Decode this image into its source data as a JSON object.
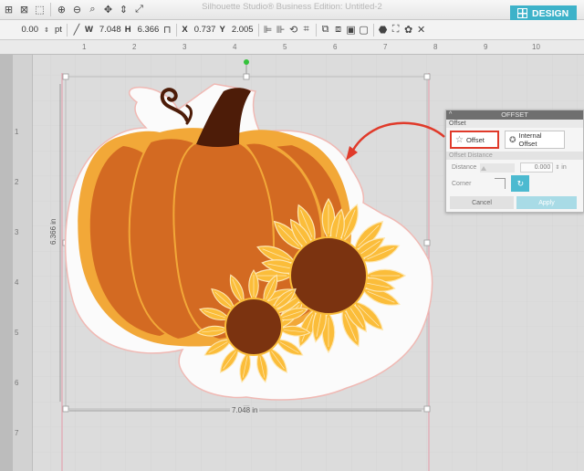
{
  "window": {
    "title": "Silhouette Studio® Business Edition: Untitled-2"
  },
  "topbar": {
    "icons": [
      "select-all-icon",
      "deselect-icon",
      "select-tool-icon",
      "zoom-in-icon",
      "zoom-out-icon",
      "zoom-box-icon",
      "pan-icon",
      "fit-to-page-icon",
      "full-screen-icon"
    ],
    "design_label": "DESIGN"
  },
  "toolbar2": {
    "line_weight": "0.00",
    "line_unit": "pt",
    "width_label": "W",
    "width_value": "7.048",
    "height_label": "H",
    "height_value": "6.366",
    "x_label": "X",
    "x_value": "0.737",
    "y_label": "Y",
    "y_value": "2.005"
  },
  "canvas": {
    "width_dimension": "7.048 in",
    "height_dimension": "6.366 in"
  },
  "ruler": {
    "top_labels": [
      "1",
      "2",
      "3",
      "4",
      "5",
      "6",
      "7",
      "8",
      "9",
      "10"
    ],
    "left_labels": [
      "1",
      "2",
      "3",
      "4",
      "5",
      "6",
      "7"
    ]
  },
  "offset_panel": {
    "header": "OFFSET",
    "section_offset": "Offset",
    "offset_button": "Offset",
    "internal_offset_button": "Internal Offset",
    "section_distance": "Offset Distance",
    "distance_label": "Distance",
    "distance_value": "0.000",
    "distance_unit": "in",
    "corner_label": "Corner",
    "cancel": "Cancel",
    "apply": "Apply"
  },
  "colors": {
    "accent": "#3db2c9",
    "pumpkin": "#d36a22",
    "pumpkin_outline": "#f2a838",
    "stem": "#4d1c08",
    "petal": "#fbbd3a",
    "sunflower_center": "#7b3310",
    "offset_outline": "#f3c9c6",
    "highlight": "#e03a2a"
  }
}
